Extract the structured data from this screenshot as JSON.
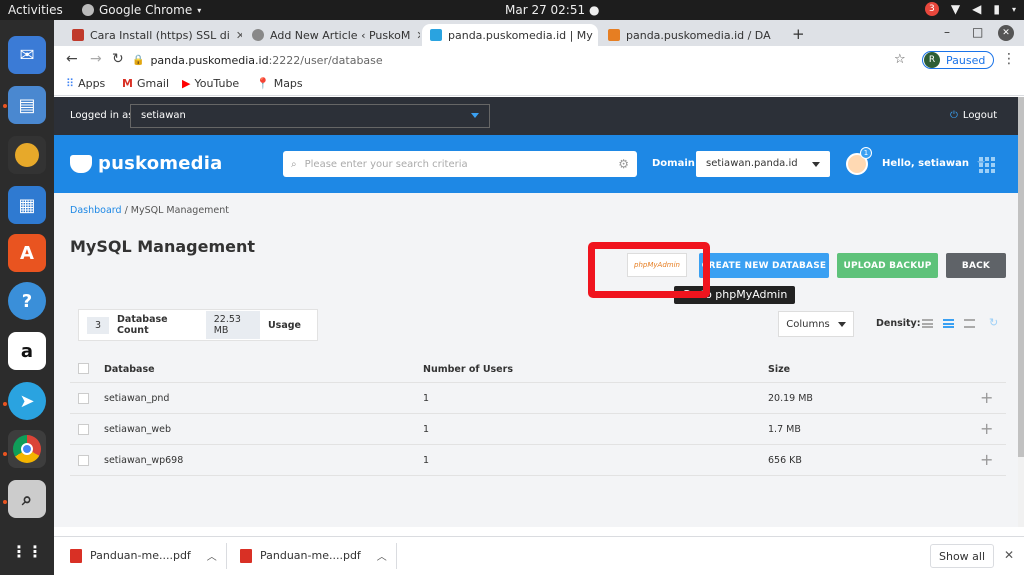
{
  "os_bar": {
    "activities": "Activities",
    "app_name": "Google Chrome",
    "clock": "Mar 27  02:51",
    "notification_count": "3"
  },
  "dock": {
    "items": [
      "mail-icon",
      "files-icon",
      "speaker-icon",
      "document-icon",
      "software-center-icon",
      "help-icon",
      "amazon-icon",
      "telegram-icon",
      "chrome-icon",
      "screenshot-icon",
      "apps-grid-icon"
    ]
  },
  "tabs": [
    {
      "title": "Cara Install (https) SSL di"
    },
    {
      "title": "Add New Article ‹ PuskoM"
    },
    {
      "title": "panda.puskomedia.id | My"
    },
    {
      "title": "panda.puskomedia.id / DA"
    }
  ],
  "address_bar": {
    "host": "panda.puskomedia.id",
    "path": ":2222/user/database",
    "profile_initial": "R",
    "profile_status": "Paused"
  },
  "bookmarks": [
    {
      "label": "Apps"
    },
    {
      "label": "Gmail"
    },
    {
      "label": "YouTube"
    },
    {
      "label": "Maps"
    }
  ],
  "page": {
    "logged_in_label": "Logged in as",
    "logged_in_user": "setiawan",
    "logout_label": "Logout",
    "brand": "puskomedia",
    "search_placeholder": "Please enter your search criteria",
    "domain_label": "Domain",
    "domain_value": "setiawan.panda.id",
    "notification_badge": "1",
    "hello_text": "Hello, setiawan",
    "breadcrumb_dashboard": "Dashboard",
    "breadcrumb_current": " / MySQL Management",
    "title": "MySQL Management",
    "phpmyadmin_logo_text": "phpMyAdmin",
    "tooltip": "Go to phpMyAdmin",
    "create_button": "CREATE NEW DATABASE",
    "upload_button": "UPLOAD BACKUP",
    "back_button": "BACK",
    "stats": {
      "db_count": "3",
      "db_count_label": "Database Count",
      "usage": "22.53 MB",
      "usage_label": "Usage"
    },
    "columns_button": "Columns",
    "density_label": "Density:",
    "table": {
      "headers": [
        "Database",
        "Number of Users",
        "Size"
      ],
      "rows": [
        {
          "name": "setiawan_pnd",
          "users": "1",
          "size": "20.19 MB"
        },
        {
          "name": "setiawan_web",
          "users": "1",
          "size": "1.7 MB"
        },
        {
          "name": "setiawan_wp698",
          "users": "1",
          "size": "656 KB"
        }
      ]
    }
  },
  "downloads": {
    "items": [
      {
        "name": "Panduan-me....pdf"
      },
      {
        "name": "Panduan-me....pdf"
      }
    ],
    "show_all": "Show all"
  },
  "colors": {
    "brand_blue": "#1e88e5",
    "create_button": "#3aa0f2",
    "upload_button": "#5ec27a",
    "back_button": "#5f6368",
    "highlight_box": "#f0141e"
  }
}
